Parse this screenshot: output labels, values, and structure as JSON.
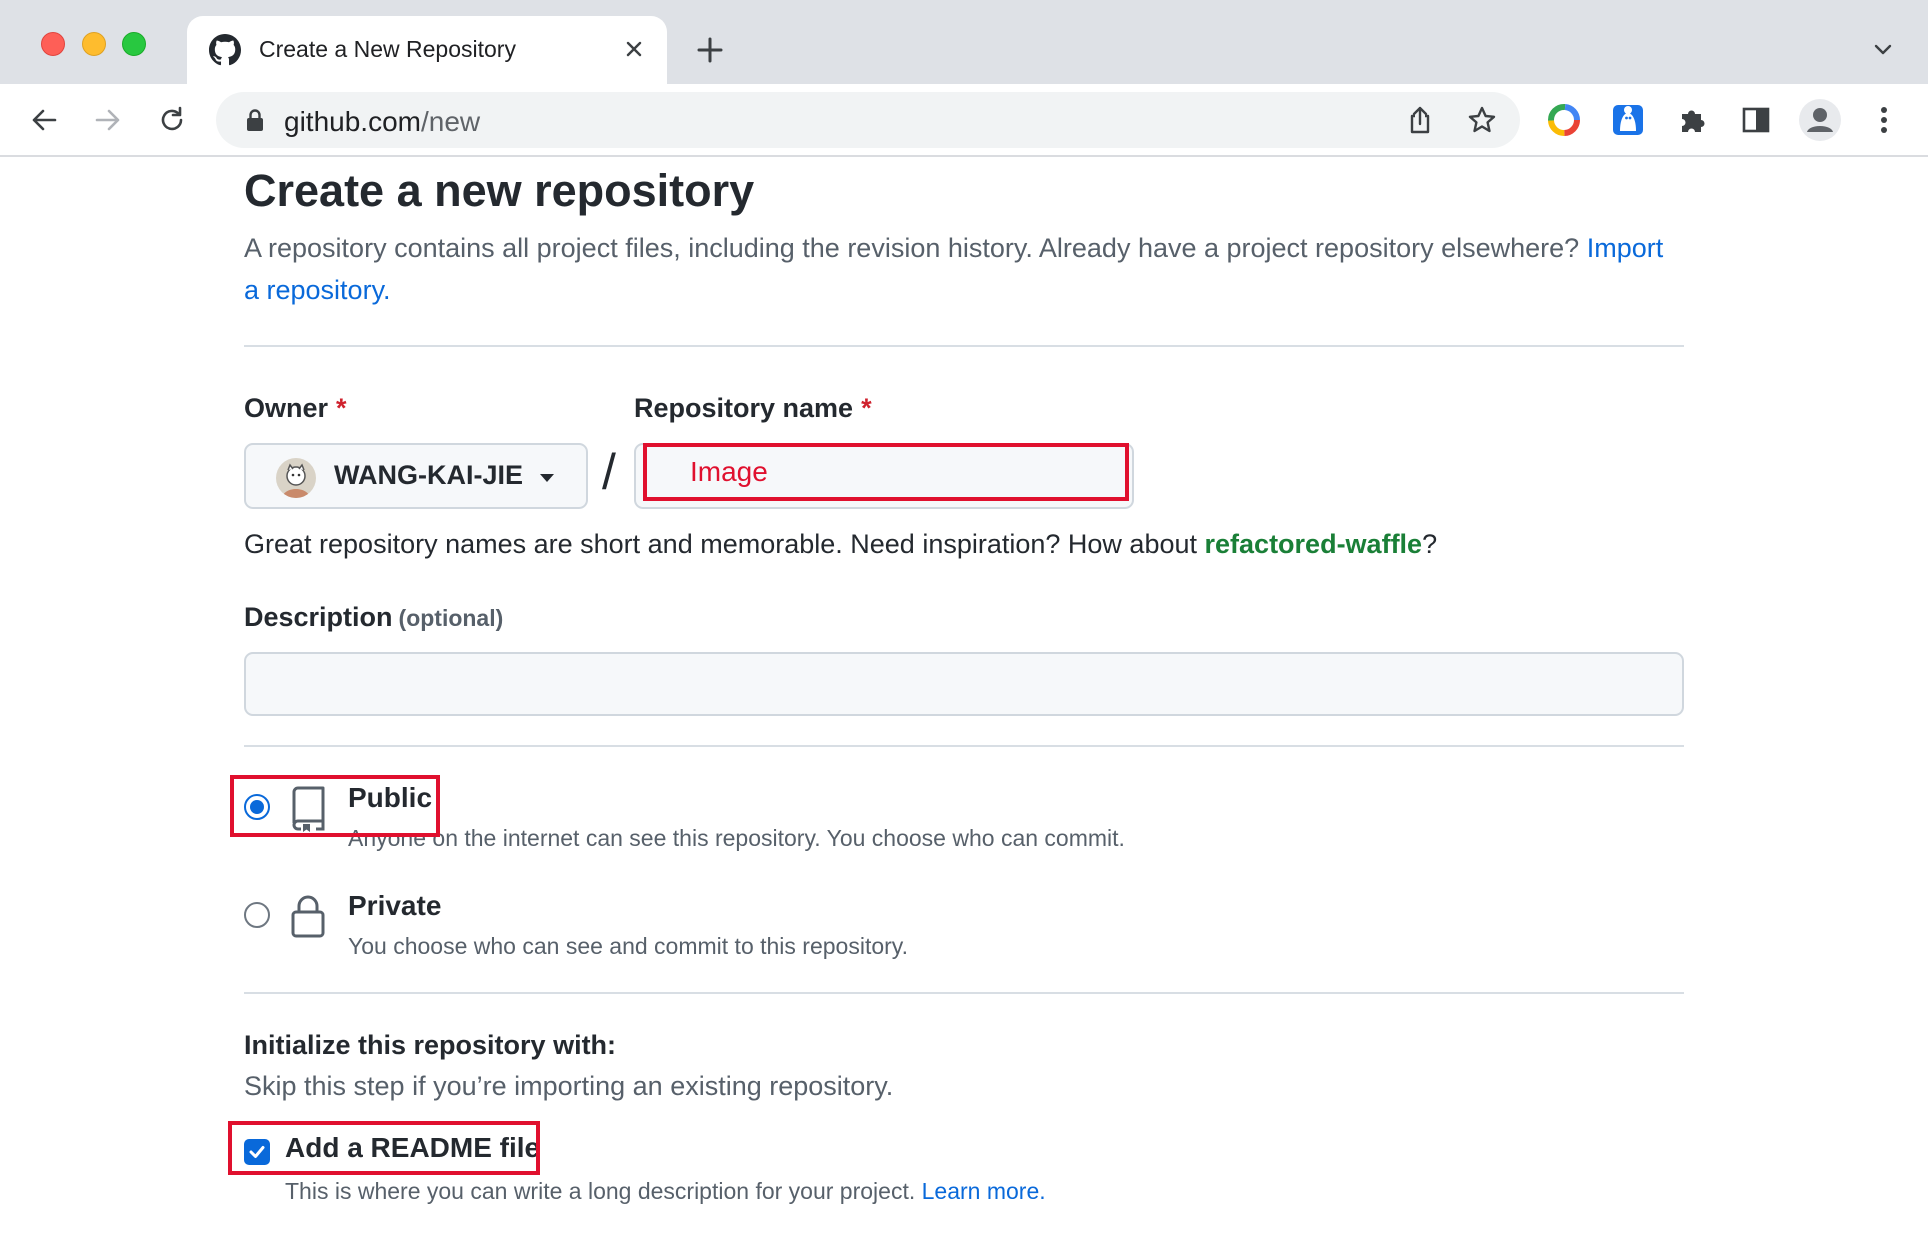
{
  "browser": {
    "tab": {
      "title": "Create a New Repository",
      "favicon": "github-logo-icon"
    },
    "url_host": "github.com",
    "url_path": "/new",
    "icons": {
      "back": "arrow-left-icon",
      "forward": "arrow-right-icon",
      "reload": "reload-icon",
      "share": "share-icon",
      "bookmark": "star-icon",
      "extensions": "puzzle-icon",
      "side_panel": "side-panel-icon",
      "profile": "profile-icon",
      "menu": "kebab-menu-icon"
    }
  },
  "page": {
    "title": "Create a new repository",
    "intro": "A repository contains all project files, including the revision history. Already have a project repository elsewhere?",
    "import_link": "Import a repository.",
    "owner_label": "Owner",
    "repo_label": "Repository name",
    "required_mark": "*",
    "owner_name": "WANG-KAI-JIE",
    "separator": "/",
    "repo_name_value": "Image",
    "hint_prefix": "Great repository names are short and memorable. Need inspiration? How about",
    "hint_suggestion": "refactored-waffle",
    "hint_suffix": "?",
    "description_label": "Description",
    "description_optional": "(optional)",
    "description_value": "",
    "visibility": {
      "selected": "Public",
      "public_title": "Public",
      "public_desc": "Anyone on the internet can see this repository. You choose who can commit.",
      "private_title": "Private",
      "private_desc": "You choose who can see and commit to this repository."
    },
    "init_title": "Initialize this repository with:",
    "init_subtitle": "Skip this step if you’re importing an existing repository.",
    "readme_checked": true,
    "readme_label": "Add a README file",
    "readme_desc": "This is where you can write a long description for your project.",
    "readme_link": "Learn more."
  },
  "colors": {
    "accent_blue": "#0969da",
    "highlight_red": "#e0102e",
    "suggestion_green": "#1a7f37"
  }
}
